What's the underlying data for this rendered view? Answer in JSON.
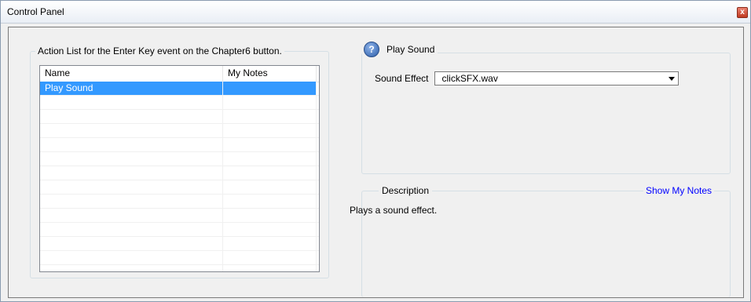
{
  "window": {
    "title": "Control Panel",
    "close_glyph": "x"
  },
  "action_list": {
    "caption": "Action List for the Enter Key event on the Chapter6 button.",
    "columns": [
      "Name",
      "My Notes"
    ],
    "rows": [
      {
        "name": "Play Sound",
        "notes": "",
        "selected": true
      }
    ]
  },
  "action_settings": {
    "help_icon": "question-icon",
    "help_glyph": "?",
    "title": "Play Sound",
    "sound_effect_label": "Sound Effect",
    "sound_effect_value": "clickSFX.wav"
  },
  "description": {
    "label": "Description",
    "show_notes_link": "Show My Notes",
    "text": "Plays a sound effect."
  },
  "colors": {
    "selection": "#3399ff",
    "link": "#0000ff"
  }
}
